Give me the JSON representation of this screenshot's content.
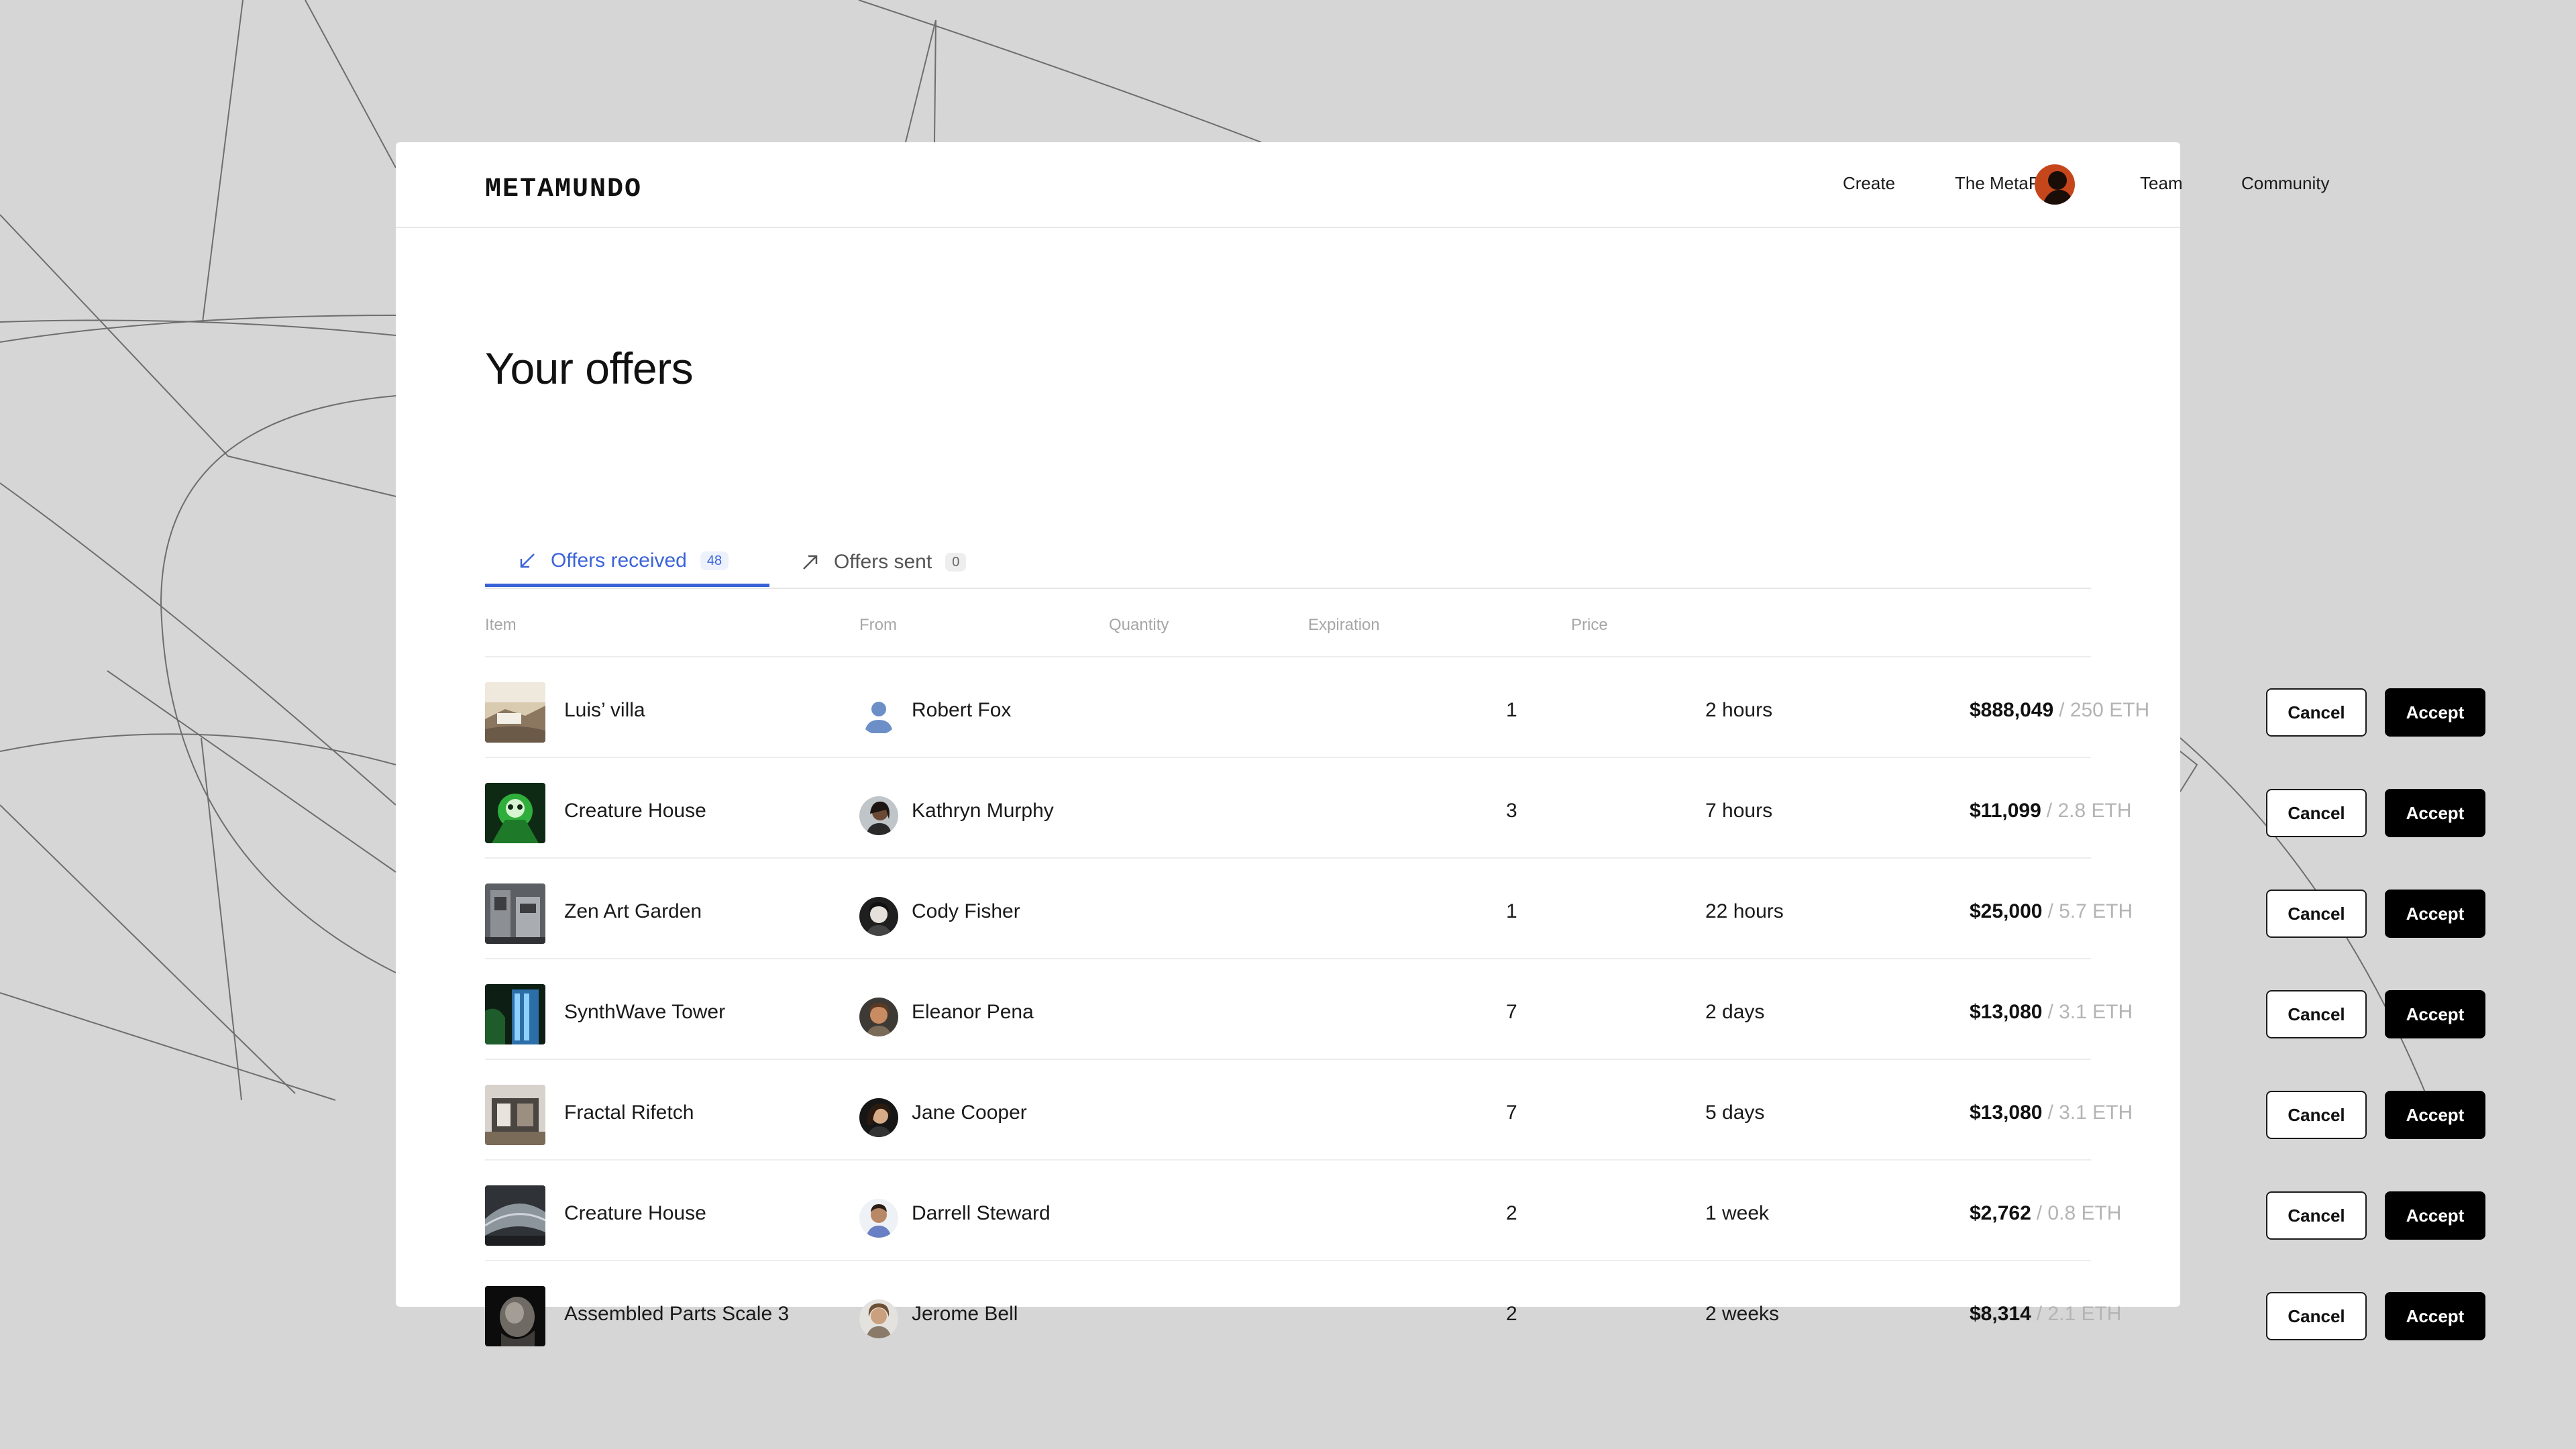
{
  "brand": {
    "logo_text": "METAMUNDO"
  },
  "nav": {
    "items": [
      "Create",
      "The MetaPortal",
      "Team",
      "Community"
    ]
  },
  "page": {
    "title": "Your offers"
  },
  "tabs": [
    {
      "label": "Offers received",
      "count": "48",
      "icon": "arrow-down-left-icon",
      "active": true
    },
    {
      "label": "Offers sent",
      "count": "0",
      "icon": "arrow-up-right-icon",
      "active": false
    }
  ],
  "table": {
    "columns": [
      "Item",
      "From",
      "Quantity",
      "Expiration",
      "Price"
    ],
    "cancel_label": "Cancel",
    "accept_label": "Accept",
    "rows": [
      {
        "item": "Luis’ villa",
        "from": "Robert Fox",
        "quantity": "1",
        "expiration": "2 hours",
        "price_usd": "$888,049",
        "price_eth": "/ 250 ETH"
      },
      {
        "item": "Creature House",
        "from": "Kathryn Murphy",
        "quantity": "3",
        "expiration": "7 hours",
        "price_usd": "$11,099",
        "price_eth": "/ 2.8 ETH"
      },
      {
        "item": "Zen Art Garden",
        "from": "Cody Fisher",
        "quantity": "1",
        "expiration": "22 hours",
        "price_usd": "$25,000",
        "price_eth": "/ 5.7 ETH"
      },
      {
        "item": "SynthWave Tower",
        "from": "Eleanor Pena",
        "quantity": "7",
        "expiration": "2 days",
        "price_usd": "$13,080",
        "price_eth": "/ 3.1 ETH"
      },
      {
        "item": "Fractal Rifetch",
        "from": "Jane Cooper",
        "quantity": "7",
        "expiration": "5 days",
        "price_usd": "$13,080",
        "price_eth": "/ 3.1 ETH"
      },
      {
        "item": "Creature House",
        "from": "Darrell Steward",
        "quantity": "2",
        "expiration": "1 week",
        "price_usd": "$2,762",
        "price_eth": "/ 0.8 ETH"
      },
      {
        "item": "Assembled Parts Scale 3",
        "from": "Jerome Bell",
        "quantity": "2",
        "expiration": "2 weeks",
        "price_usd": "$8,314",
        "price_eth": "/ 2.1 ETH"
      }
    ]
  },
  "colors": {
    "accent": "#3a63d8",
    "background": "#d6d6d6",
    "card": "#ffffff",
    "accept_button": "#000000"
  }
}
